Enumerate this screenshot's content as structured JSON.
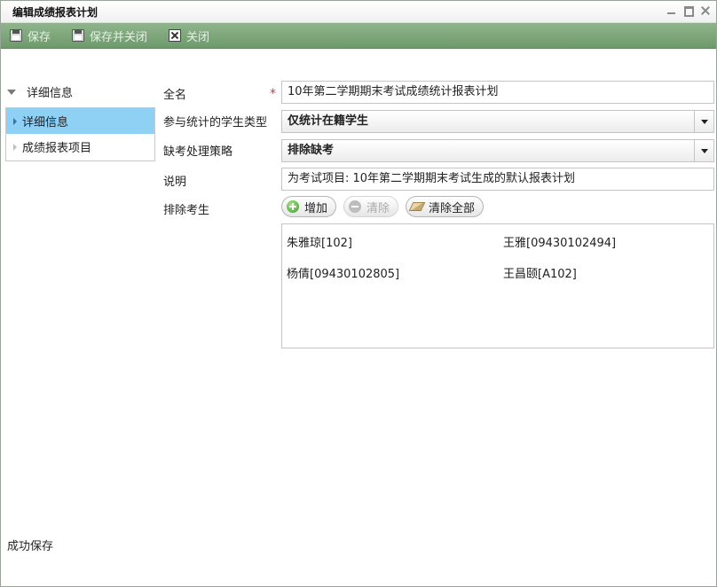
{
  "window": {
    "title": "编辑成绩报表计划"
  },
  "toolbar": {
    "save_label": "保存",
    "save_close_label": "保存并关闭",
    "close_label": "关闭"
  },
  "nav": {
    "header": "详细信息",
    "items": [
      {
        "label": "详细信息",
        "active": true
      },
      {
        "label": "成绩报表项目",
        "active": false
      }
    ]
  },
  "form": {
    "fullname": {
      "label": "全名",
      "required_mark": "*",
      "value": "10年第二学期期末考试成绩统计报表计划"
    },
    "student_type": {
      "label": "参与统计的学生类型",
      "value": "仅统计在籍学生"
    },
    "absence_policy": {
      "label": "缺考处理策略",
      "value": "排除缺考"
    },
    "description": {
      "label": "说明",
      "value": "为考试项目: 10年第二学期期末考试生成的默认报表计划"
    },
    "excluded": {
      "label": "排除考生",
      "add_label": "增加",
      "clear_label": "清除",
      "clear_all_label": "清除全部",
      "students": [
        "朱雅琼[102]",
        "王雅[09430102494]",
        "杨倩[09430102805]",
        "王昌颐[A102]"
      ]
    }
  },
  "status": {
    "text": "成功保存"
  },
  "colors": {
    "toolbar": "#7da77a",
    "nav_active": "#8fd0f5",
    "required": "#dd3333"
  }
}
